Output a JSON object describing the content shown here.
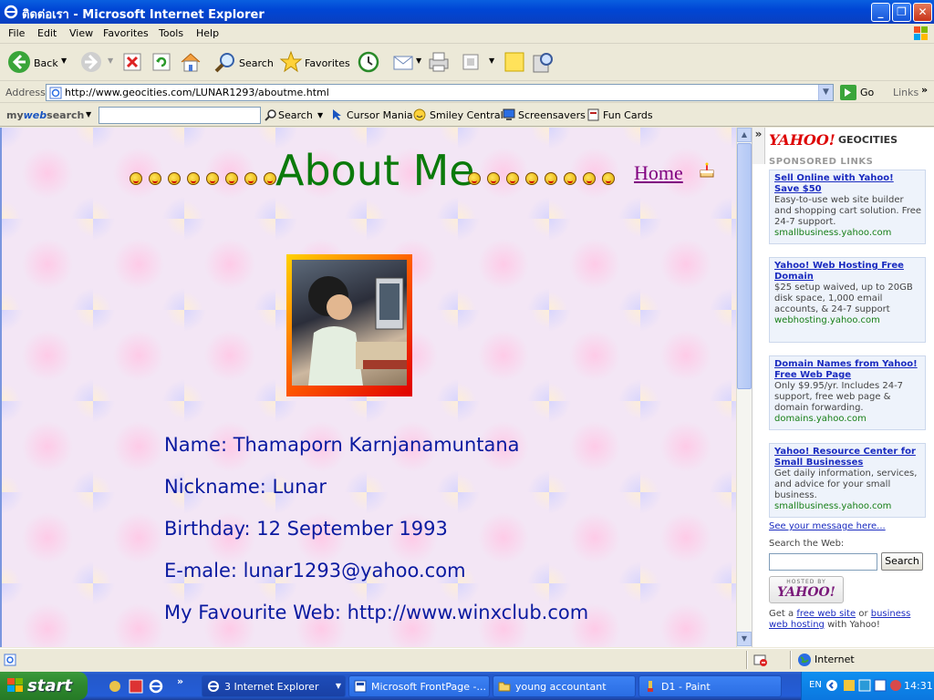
{
  "window": {
    "title": "ติดต่อเรา - Microsoft Internet Explorer"
  },
  "menu": [
    "File",
    "Edit",
    "View",
    "Favorites",
    "Tools",
    "Help"
  ],
  "toolbar": {
    "back": "Back",
    "search": "Search",
    "favorites": "Favorites"
  },
  "address": {
    "label": "Address",
    "url": "http://www.geocities.com/LUNAR1293/aboutme.html",
    "go": "Go",
    "links": "Links"
  },
  "mywebsearch": {
    "brand_my": "my",
    "brand_web": "web",
    "brand_search": "search",
    "search": "Search",
    "items": [
      "Cursor Mania",
      "Smiley Central",
      "Screensavers",
      "Fun Cards"
    ]
  },
  "page": {
    "heading": "About Me",
    "home": "Home",
    "lines": [
      "Name: Thamaporn Karnjanamuntana",
      "Nickname: Lunar",
      "Birthday: 12 September 1993",
      "E-male: lunar1293@yahoo.com",
      "My Favourite Web: http://www.winxclub.com"
    ]
  },
  "sidebar": {
    "logo": "YAHOO!",
    "logo_suffix": "GEOCITIES",
    "sponsored": "SPONSORED LINKS",
    "ads": [
      {
        "title": "Sell Online with Yahoo! Save $50",
        "desc": "Easy-to-use web site builder and shopping cart solution. Free 24-7 support.",
        "url": "smallbusiness.yahoo.com"
      },
      {
        "title": "Yahoo! Web Hosting Free Domain",
        "desc": "$25 setup waived, up to 20GB disk space, 1,000 email accounts, & 24-7 support",
        "url": "webhosting.yahoo.com"
      },
      {
        "title": "Domain Names from Yahoo! Free Web Page",
        "desc": "Only $9.95/yr. Includes 24-7 support, free web page & domain forwarding.",
        "url": "domains.yahoo.com"
      },
      {
        "title": "Yahoo! Resource Center for Small Businesses",
        "desc": "Get daily information, services, and advice for your small business.",
        "url": "smallbusiness.yahoo.com"
      }
    ],
    "see_message": "See your message here...",
    "search_label": "Search the Web:",
    "search_button": "Search",
    "hosted_by": "HOSTED BY",
    "hosted_logo": "YAHOO!",
    "get_prefix": "Get a ",
    "get_link1": "free web site",
    "get_mid": " or ",
    "get_link2": "business web hosting",
    "get_suffix": " with Yahoo!"
  },
  "status": {
    "zone": "Internet"
  },
  "taskbar": {
    "start": "start",
    "buttons": [
      "3 Internet Explorer",
      "Microsoft FrontPage -...",
      "young accountant",
      "D1 - Paint"
    ],
    "lang": "EN",
    "clock": "14:31"
  }
}
